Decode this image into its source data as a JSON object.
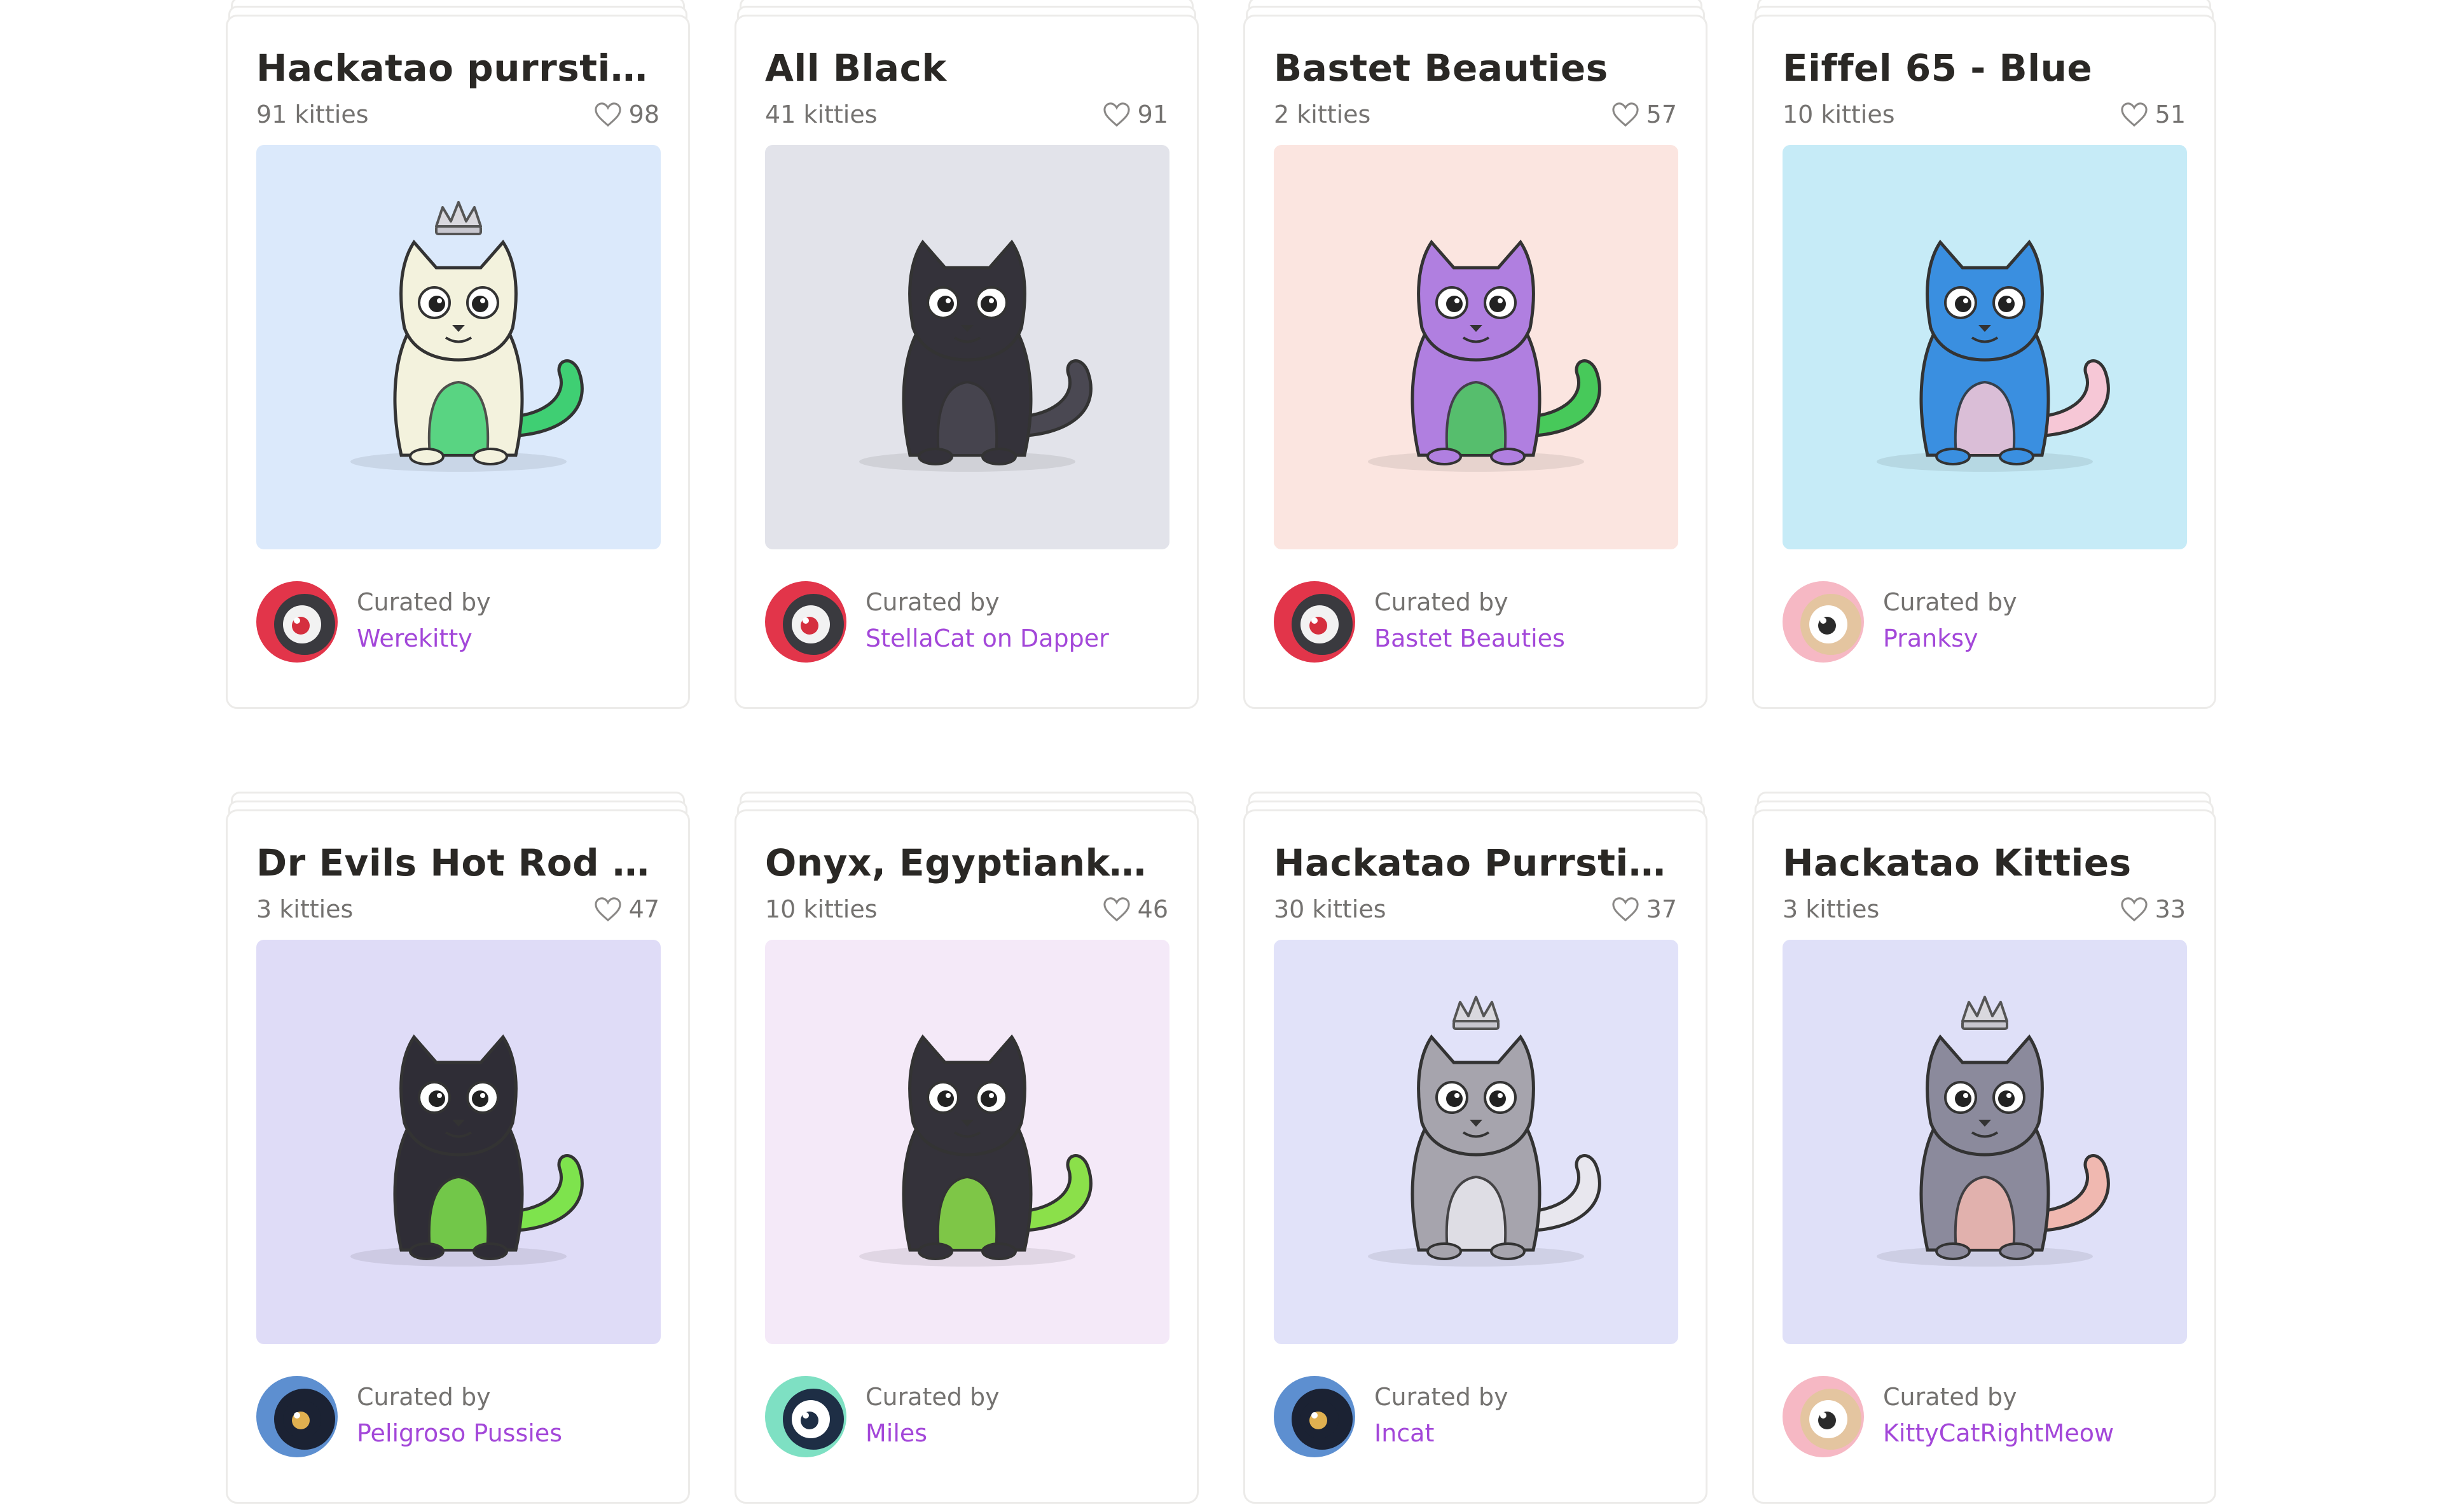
{
  "curated_by_label": "Curated by",
  "cards": [
    {
      "title": "Hackatao purrstiges",
      "count": "91 kitties",
      "likes": "98",
      "curator": "Werekitty",
      "bg": "#dbe9fb",
      "cat_body": "#f3f2dd",
      "cat_accent": "#3fcf73",
      "avatar": "red-eye",
      "crown": true
    },
    {
      "title": "All Black",
      "count": "41 kitties",
      "likes": "91",
      "curator": "StellaCat on Dapper",
      "bg": "#e2e3ea",
      "cat_body": "#34323a",
      "cat_accent": "#4a4852",
      "avatar": "red-eye",
      "crown": false
    },
    {
      "title": "Bastet Beauties",
      "count": "2 kitties",
      "likes": "57",
      "curator": "Bastet Beauties",
      "bg": "#fbe5e0",
      "cat_body": "#b07fe0",
      "cat_accent": "#47c95a",
      "avatar": "red-eye",
      "crown": false
    },
    {
      "title": "Eiffel 65 - Blue",
      "count": "10 kitties",
      "likes": "51",
      "curator": "Pranksy",
      "bg": "#c6ebf7",
      "cat_body": "#3a8fe0",
      "cat_accent": "#f6c7d6",
      "avatar": "pink-eye",
      "crown": false
    },
    {
      "title": "Dr Evils Hot Rod seri...",
      "count": "3 kitties",
      "likes": "47",
      "curator": "Peligroso Pussies",
      "bg": "#dfdcf7",
      "cat_body": "#2f2d36",
      "cat_accent": "#7ee34d",
      "avatar": "blue-eye",
      "crown": false
    },
    {
      "title": "Onyx, Egyptiankohl, ...",
      "count": "10 kitties",
      "likes": "46",
      "curator": "Miles",
      "bg": "#f4e9f8",
      "cat_body": "#34323a",
      "cat_accent": "#8be04a",
      "avatar": "teal-eye",
      "crown": false
    },
    {
      "title": "Hackatao Purrstige",
      "count": "30 kitties",
      "likes": "37",
      "curator": "Incat",
      "bg": "#e1e2f9",
      "cat_body": "#a6a4ad",
      "cat_accent": "#e8e7ee",
      "avatar": "blue-eye",
      "crown": true
    },
    {
      "title": "Hackatao Kitties",
      "count": "3 kitties",
      "likes": "33",
      "curator": "KittyCatRightMeow",
      "bg": "#dfe0f8",
      "cat_body": "#8b8a9c",
      "cat_accent": "#f0b8b0",
      "avatar": "pink-eye",
      "crown": true
    }
  ]
}
